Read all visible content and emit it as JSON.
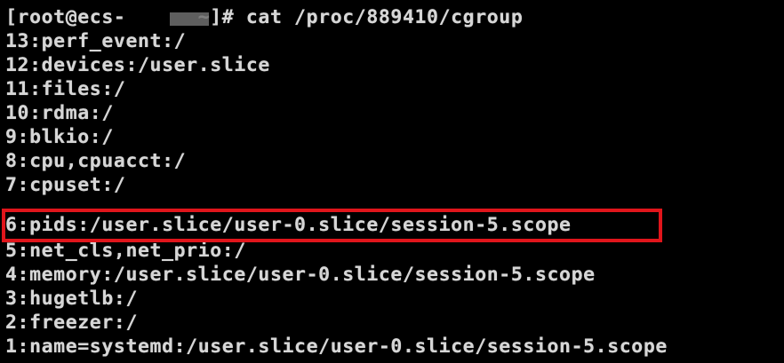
{
  "terminal": {
    "text_color": "#d6d6d6",
    "background": "#000000",
    "highlight_color": "#e0151b",
    "lines": [
      "[root@ecs-      ~]# cat /proc/889410/cgroup",
      "13:perf_event:/",
      "12:devices:/user.slice",
      "11:files:/",
      "10:rdma:/",
      "9:blkio:/",
      "8:cpu,cpuacct:/",
      "7:cpuset:/",
      "6:pids:/user.slice/user-0.slice/session-5.scope",
      "5:net_cls,net_prio:/",
      "4:memory:/user.slice/user-0.slice/session-5.scope",
      "3:hugetlb:/",
      "2:freezer:/",
      "1:name=systemd:/user.slice/user-0.slice/session-5.scope"
    ]
  }
}
